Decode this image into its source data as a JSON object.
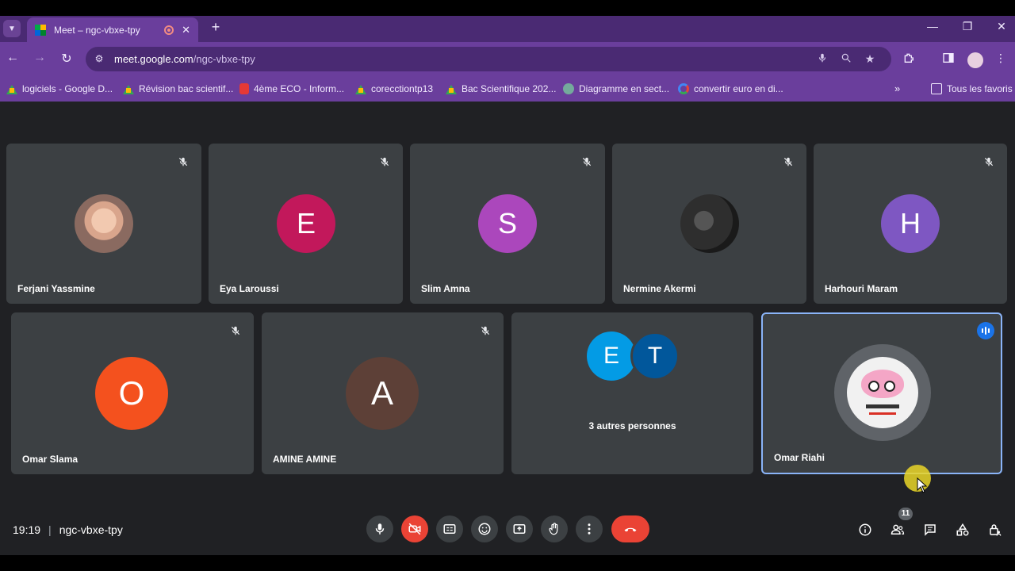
{
  "browser": {
    "tab_title": "Meet – ngc-vbxe-tpy",
    "url_host": "meet.google.com",
    "url_path": "/ngc-vbxe-tpy",
    "bookmarks": [
      {
        "label": "logiciels - Google D...",
        "icon": "drive-icon"
      },
      {
        "label": "Révision bac scientif...",
        "icon": "drive-icon"
      },
      {
        "label": "4ème ECO - Inform...",
        "icon": "pdf-icon"
      },
      {
        "label": "corecctiontp13",
        "icon": "drive-icon"
      },
      {
        "label": "Bac Scientifique 202...",
        "icon": "drive-icon"
      },
      {
        "label": "Diagramme en sect...",
        "icon": "chatgpt-icon"
      },
      {
        "label": "convertir euro en di...",
        "icon": "google-icon"
      }
    ],
    "all_bookmarks_label": "Tous les favoris"
  },
  "participants_row1": [
    {
      "name": "Ferjani Yassmine",
      "initial": "",
      "color": "",
      "muted": true,
      "photo": true
    },
    {
      "name": "Eya Laroussi",
      "initial": "E",
      "color": "#c2185b",
      "muted": true
    },
    {
      "name": "Slim Amna",
      "initial": "S",
      "color": "#ab47bc",
      "muted": true
    },
    {
      "name": "Nermine Akermi",
      "initial": "",
      "color": "",
      "muted": true,
      "photo": true
    },
    {
      "name": "Harhouri Maram",
      "initial": "H",
      "color": "#7e57c2",
      "muted": true
    }
  ],
  "participants_row2": [
    {
      "name": "Omar Slama",
      "initial": "O",
      "color": "#f4511e",
      "muted": true
    },
    {
      "name": "AMINE AMINE",
      "initial": "A",
      "color": "#5d4037",
      "muted": true
    }
  ],
  "others_tile": {
    "initials": [
      "E",
      "T"
    ],
    "colors": [
      "#039be5",
      "#01579b"
    ],
    "label": "3 autres personnes"
  },
  "active_speaker": {
    "name": "Omar Riahi"
  },
  "meeting": {
    "time": "19:19",
    "code": "ngc-vbxe-tpy",
    "participant_count": "11"
  }
}
